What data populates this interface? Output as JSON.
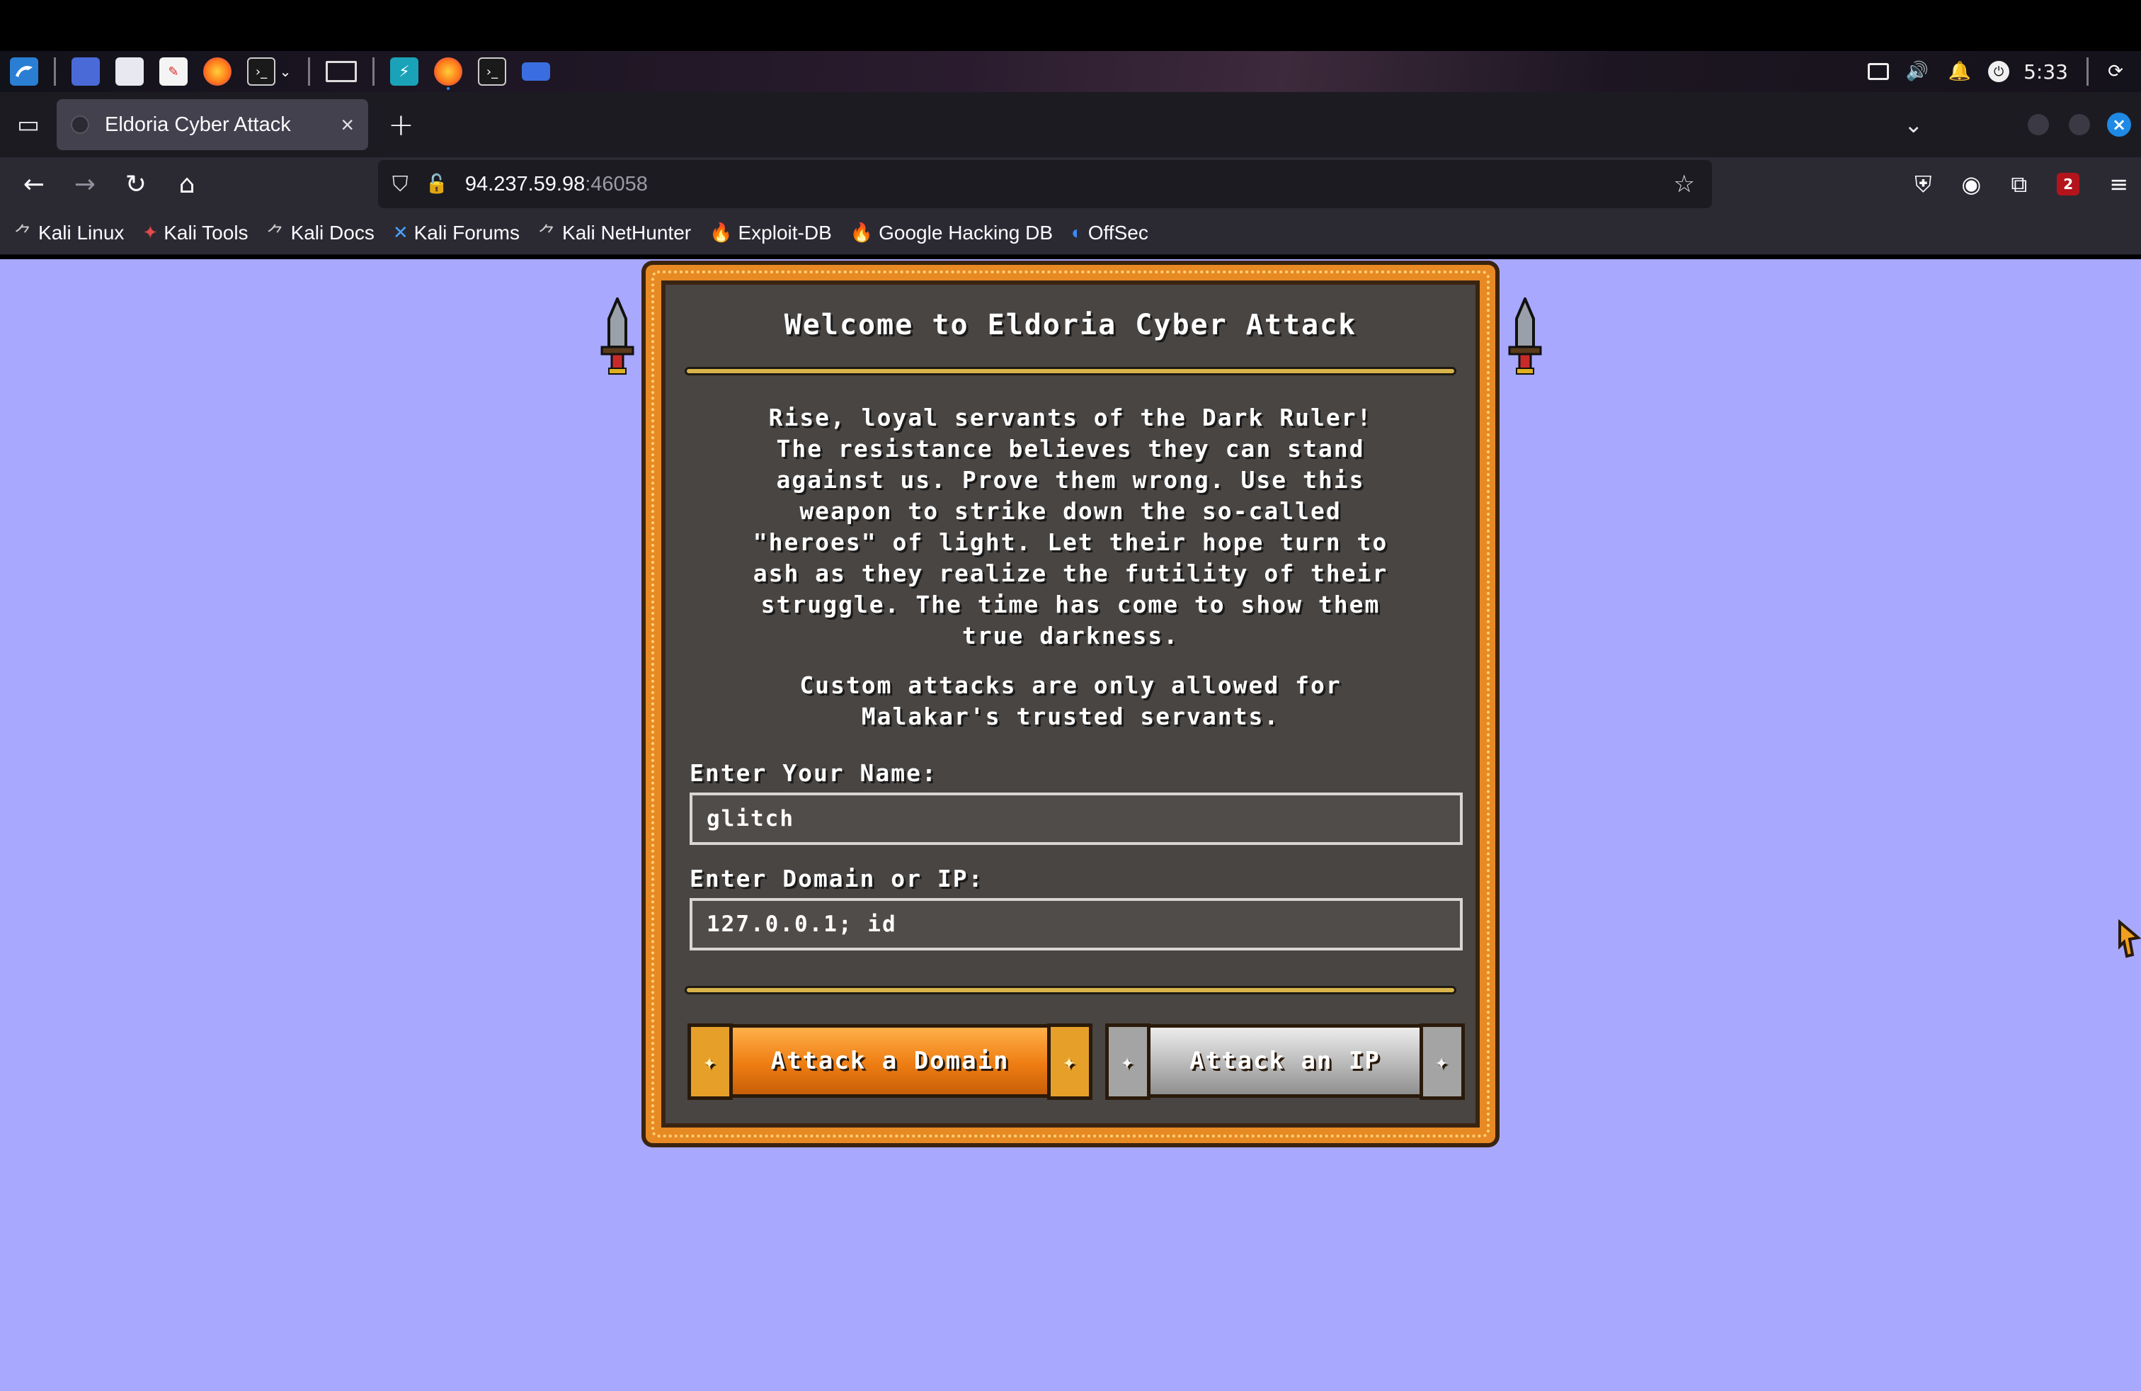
{
  "taskbar": {
    "clock": "5:33",
    "icons": [
      "kali-menu-icon",
      "workspace-icon",
      "file-manager-icon",
      "text-editor-icon",
      "firefox-icon",
      "terminal-icon",
      "window-icon",
      "burp-icon",
      "firefox-running-icon",
      "terminal-running-icon",
      "folder-running-icon"
    ],
    "tray_icons": [
      "display-icon",
      "volume-icon",
      "bell-icon",
      "power-icon",
      "refresh-icon"
    ]
  },
  "browser": {
    "tab_title": "Eldoria Cyber Attack",
    "url_host": "94.237.59.98",
    "url_port": ":46058",
    "ublock_badge": "2",
    "bookmarks": [
      {
        "label": "Kali Linux",
        "icon": "kali-dragon-icon"
      },
      {
        "label": "Kali Tools",
        "icon": "kali-tools-icon"
      },
      {
        "label": "Kali Docs",
        "icon": "kali-dragon-icon"
      },
      {
        "label": "Kali Forums",
        "icon": "kali-forums-icon"
      },
      {
        "label": "Kali NetHunter",
        "icon": "kali-dragon-icon"
      },
      {
        "label": "Exploit-DB",
        "icon": "exploit-db-icon"
      },
      {
        "label": "Google Hacking DB",
        "icon": "exploit-db-icon"
      },
      {
        "label": "OffSec",
        "icon": "offsec-icon"
      }
    ]
  },
  "page": {
    "background": "#a8a8ff",
    "accent": "#e88a24",
    "title": "Welcome to Eldoria Cyber Attack",
    "story_lines": [
      "Rise, loyal servants of the Dark Ruler!",
      "The resistance believes they can stand",
      "against us. Prove them wrong. Use this",
      "weapon to strike down the so-called",
      "\"heroes\" of light. Let their hope turn to",
      "ash as they realize the futility of their",
      "struggle. The time has come to show them",
      "true darkness."
    ],
    "custom_note_lines": [
      "Custom attacks are only allowed for",
      "Malakar's trusted servants."
    ],
    "name_label": "Enter Your Name:",
    "name_value": "glitch",
    "target_label": "Enter Domain or IP:",
    "target_value": "127.0.0.1; id",
    "attack_domain_label": "Attack a Domain",
    "attack_ip_label": "Attack an IP"
  }
}
